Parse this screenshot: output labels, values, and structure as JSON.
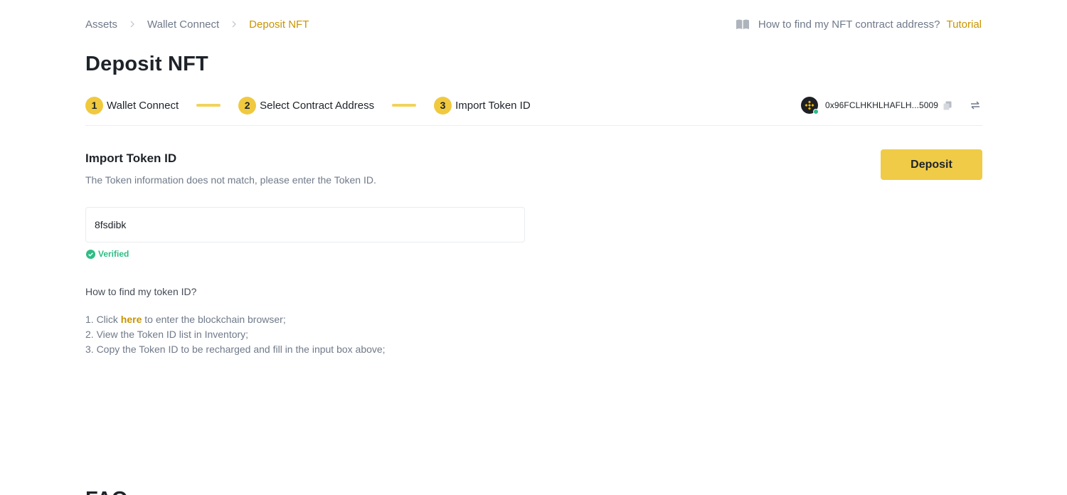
{
  "breadcrumb": {
    "items": [
      "Assets",
      "Wallet Connect",
      "Deposit NFT"
    ]
  },
  "tutorial": {
    "question": "How to find my NFT contract address?",
    "link": "Tutorial",
    "icon": "book-icon"
  },
  "page": {
    "title": "Deposit NFT"
  },
  "steps": [
    {
      "num": "1",
      "label": "Wallet Connect"
    },
    {
      "num": "2",
      "label": "Select Contract Address"
    },
    {
      "num": "3",
      "label": "Import Token ID"
    }
  ],
  "wallet": {
    "address": "0x96FCLHKHLHAFLH...5009",
    "status_color": "#2ebd85",
    "icons": [
      "bnb-avatar-icon",
      "copy-icon",
      "swap-icon"
    ]
  },
  "import": {
    "title": "Import Token ID",
    "description": "The Token information does not match, please enter the Token ID.",
    "input_value": "8fsdibk",
    "verified_label": "Verified"
  },
  "actions": {
    "deposit_label": "Deposit"
  },
  "howto": {
    "title": "How to find my token ID?",
    "step1_prefix": "1. Click ",
    "step1_link": "here",
    "step1_suffix": " to enter the blockchain browser;",
    "step2": "2. View the Token ID list in Inventory;",
    "step3": "3. Copy the Token ID to be recharged and fill in the input box above;"
  },
  "faq": {
    "title": "FAQ"
  },
  "colors": {
    "accent": "#f0cb48",
    "link": "#c99400",
    "success": "#2ebd85"
  }
}
